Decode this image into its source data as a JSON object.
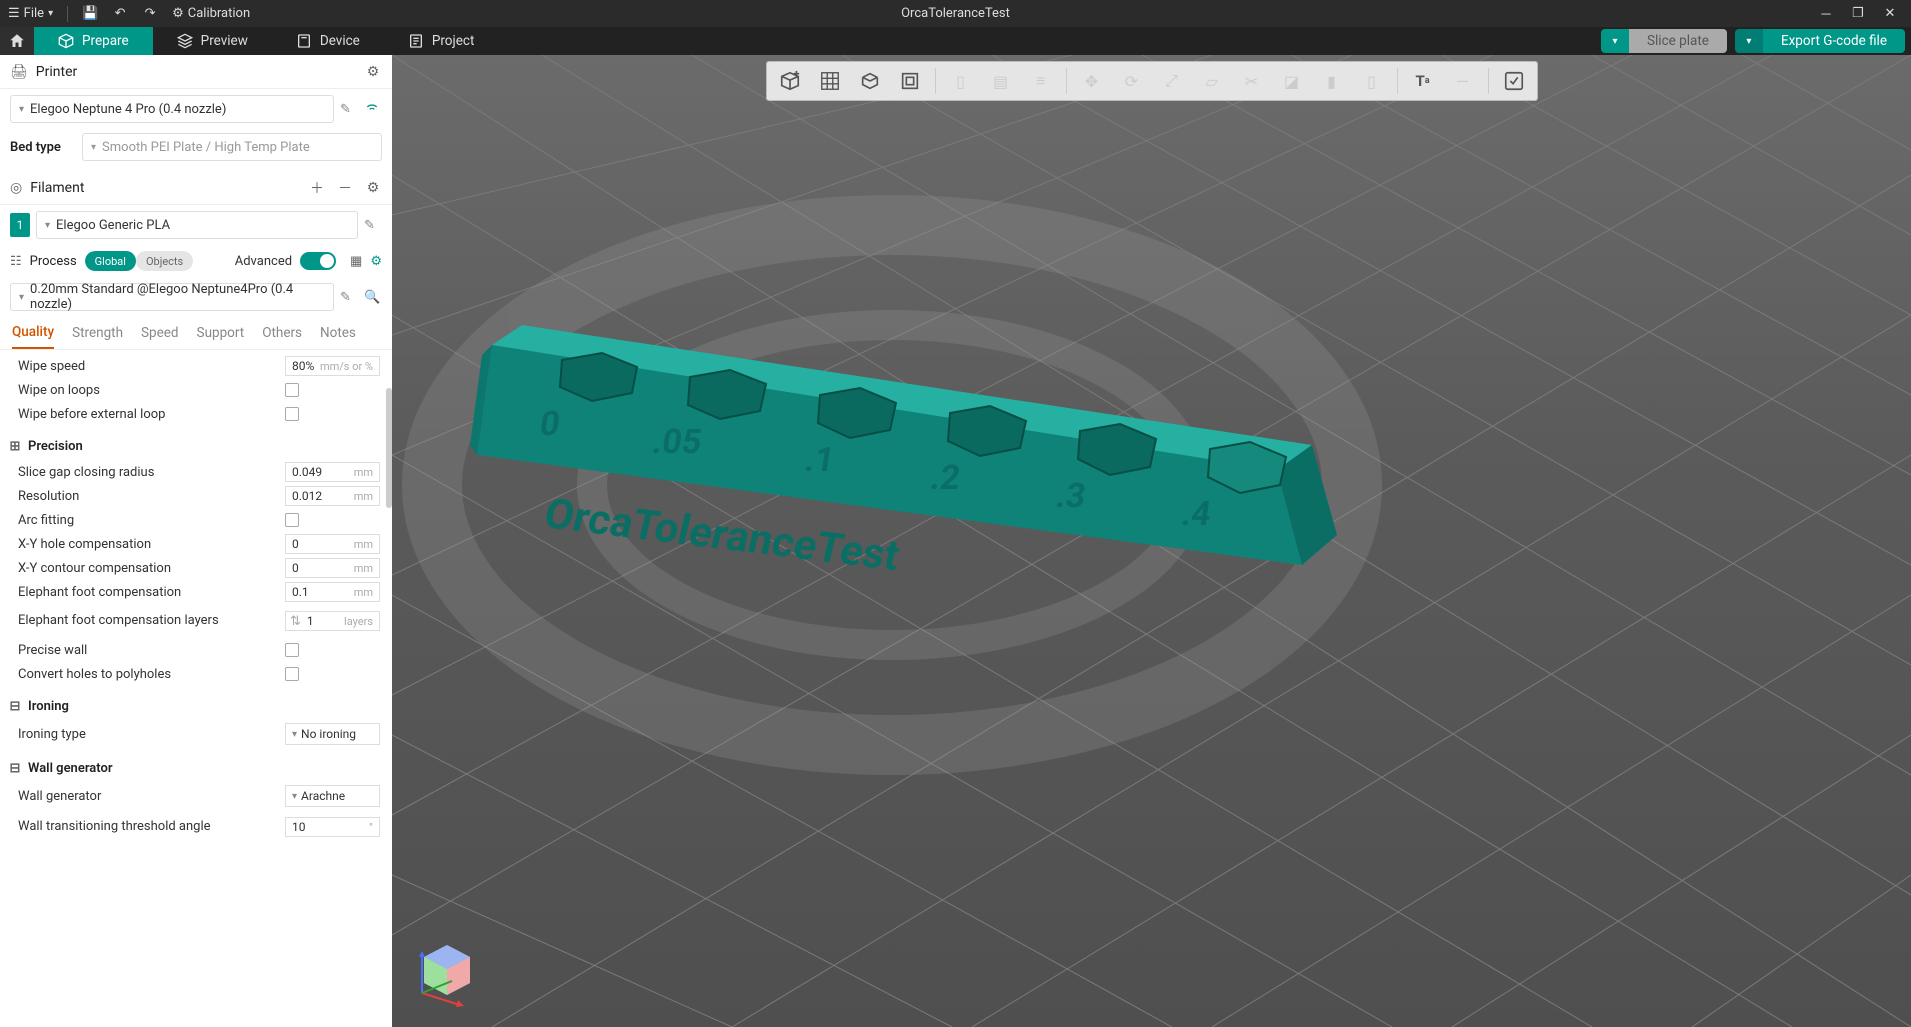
{
  "title": "OrcaToleranceTest",
  "menu": {
    "file": "File",
    "calibration": "Calibration"
  },
  "nav": {
    "prepare": "Prepare",
    "preview": "Preview",
    "device": "Device",
    "project": "Project",
    "slice": "Slice plate",
    "export": "Export G-code file"
  },
  "printer": {
    "header": "Printer",
    "selected": "Elegoo Neptune 4 Pro (0.4 nozzle)",
    "bed_label": "Bed type",
    "bed_value": "Smooth PEI Plate / High Temp Plate"
  },
  "filament": {
    "header": "Filament",
    "index": "1",
    "selected": "Elegoo Generic PLA"
  },
  "process": {
    "header": "Process",
    "global": "Global",
    "objects": "Objects",
    "advanced": "Advanced",
    "profile": "0.20mm Standard @Elegoo Neptune4Pro (0.4 nozzle)"
  },
  "tabs": {
    "quality": "Quality",
    "strength": "Strength",
    "speed": "Speed",
    "support": "Support",
    "others": "Others",
    "notes": "Notes"
  },
  "params": {
    "wipe_speed": {
      "label": "Wipe speed",
      "value": "80%",
      "unit": "mm/s or %"
    },
    "wipe_loops": {
      "label": "Wipe on loops"
    },
    "wipe_ext": {
      "label": "Wipe before external loop"
    },
    "precision": "Precision",
    "slice_gap": {
      "label": "Slice gap closing radius",
      "value": "0.049",
      "unit": "mm"
    },
    "resolution": {
      "label": "Resolution",
      "value": "0.012",
      "unit": "mm"
    },
    "arc": {
      "label": "Arc fitting"
    },
    "xy_hole": {
      "label": "X-Y hole compensation",
      "value": "0",
      "unit": "mm"
    },
    "xy_contour": {
      "label": "X-Y contour compensation",
      "value": "0",
      "unit": "mm"
    },
    "elephant": {
      "label": "Elephant foot compensation",
      "value": "0.1",
      "unit": "mm"
    },
    "elephant_layers": {
      "label": "Elephant foot compensation layers",
      "value": "1",
      "unit": "layers"
    },
    "precise_wall": {
      "label": "Precise wall"
    },
    "convert_holes": {
      "label": "Convert holes to polyholes"
    },
    "ironing": "Ironing",
    "ironing_type": {
      "label": "Ironing type",
      "value": "No ironing"
    },
    "wall_gen": "Wall generator",
    "wall_generator": {
      "label": "Wall generator",
      "value": "Arachne"
    },
    "wall_trans": {
      "label": "Wall transitioning threshold angle",
      "value": "10",
      "unit": "°"
    }
  },
  "model": {
    "labels": [
      "0",
      ".05",
      ".1",
      ".2",
      ".3",
      ".4"
    ],
    "side": "OrcaToleranceTest"
  }
}
